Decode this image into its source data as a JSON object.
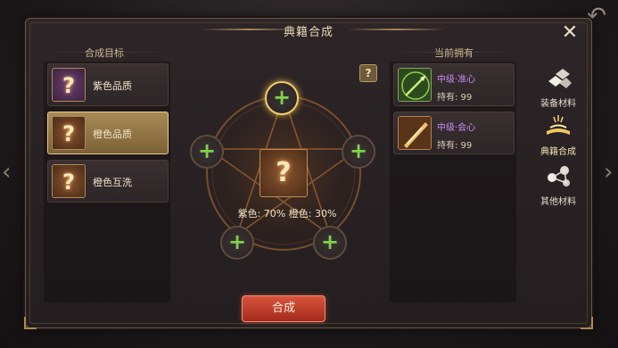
{
  "window": {
    "title": "典籍合成"
  },
  "left_panel": {
    "heading": "合成目标",
    "items": [
      {
        "label": "紫色品质",
        "icon": "question-icon",
        "color": "purple"
      },
      {
        "label": "橙色品质",
        "icon": "question-icon",
        "color": "orange",
        "selected": true
      },
      {
        "label": "橙色互洗",
        "icon": "question-icon",
        "color": "orange"
      }
    ]
  },
  "center": {
    "slot_glyph": "+",
    "main_glyph": "?",
    "help_glyph": "?",
    "ratio_text": "紫色: 70% 橙色: 30%"
  },
  "right_panel": {
    "heading": "当前拥有",
    "items": [
      {
        "name": "中级·准心",
        "count_text": "持有: 99",
        "icon": "bow-icon"
      },
      {
        "name": "中级·会心",
        "count_text": "持有: 99",
        "icon": "slash-icon"
      }
    ]
  },
  "side_tabs": [
    {
      "label": "装备材料",
      "icon": "materials-icon"
    },
    {
      "label": "典籍合成",
      "icon": "book-icon",
      "active": true
    },
    {
      "label": "其他材料",
      "icon": "nodes-icon"
    }
  ],
  "buttons": {
    "craft_label": "合成"
  },
  "colors": {
    "accent": "#d9553c",
    "slot_plus": "#7ed24a",
    "gold": "#f2cf6a",
    "item_name": "#c58cf0"
  }
}
